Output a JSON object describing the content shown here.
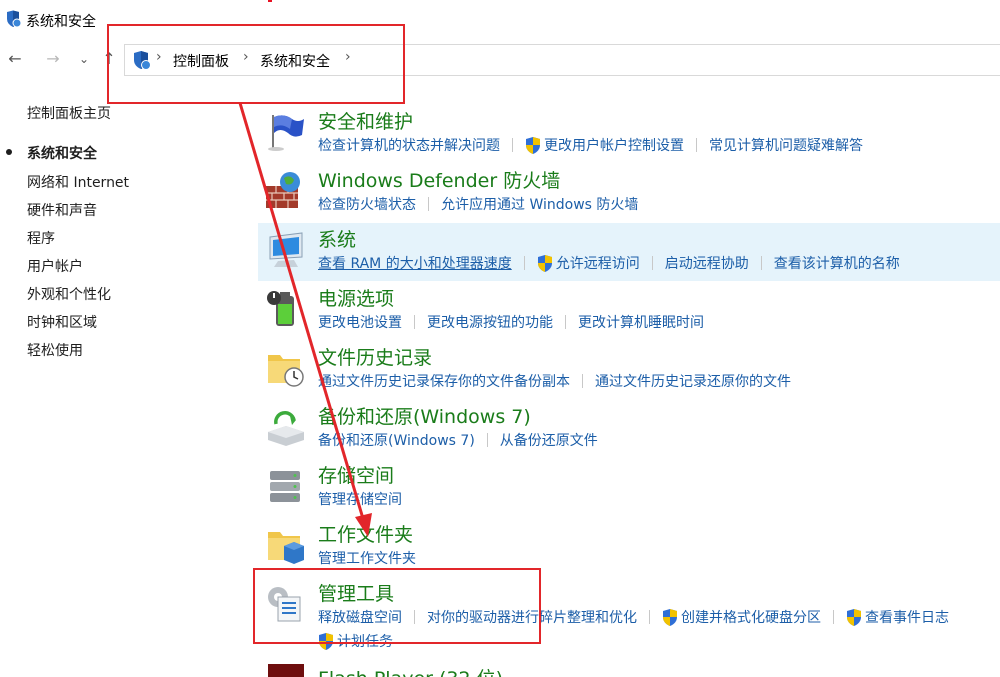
{
  "window": {
    "title": "系统和安全"
  },
  "breadcrumb": [
    {
      "label": "控制面板"
    },
    {
      "label": "系统和安全"
    }
  ],
  "left_nav": {
    "home": "控制面板主页",
    "items": [
      "系统和安全",
      "网络和 Internet",
      "硬件和声音",
      "程序",
      "用户帐户",
      "外观和个性化",
      "时钟和区域",
      "轻松使用"
    ],
    "current_index": 0
  },
  "categories": [
    {
      "title": "安全和维护",
      "icon": "flag-icon",
      "links": [
        {
          "label": "检查计算机的状态并解决问题",
          "shield": false
        },
        {
          "label": "更改用户帐户控制设置",
          "shield": true
        },
        {
          "label": "常见计算机问题疑难解答",
          "shield": false
        }
      ]
    },
    {
      "title": "Windows Defender 防火墙",
      "icon": "firewall-icon",
      "links": [
        {
          "label": "检查防火墙状态",
          "shield": false
        },
        {
          "label": "允许应用通过 Windows 防火墙",
          "shield": false
        }
      ]
    },
    {
      "title": "系统",
      "icon": "computer-icon",
      "links": [
        {
          "label": "查看 RAM 的大小和处理器速度",
          "shield": false
        },
        {
          "label": "允许远程访问",
          "shield": true
        },
        {
          "label": "启动远程协助",
          "shield": false
        },
        {
          "label": "查看该计算机的名称",
          "shield": false
        }
      ]
    },
    {
      "title": "电源选项",
      "icon": "battery-icon",
      "links": [
        {
          "label": "更改电池设置",
          "shield": false
        },
        {
          "label": "更改电源按钮的功能",
          "shield": false
        },
        {
          "label": "更改计算机睡眠时间",
          "shield": false
        }
      ]
    },
    {
      "title": "文件历史记录",
      "icon": "file-history-icon",
      "links": [
        {
          "label": "通过文件历史记录保存你的文件备份副本",
          "shield": false
        },
        {
          "label": "通过文件历史记录还原你的文件",
          "shield": false
        }
      ]
    },
    {
      "title": "备份和还原(Windows 7)",
      "icon": "backup-icon",
      "links": [
        {
          "label": "备份和还原(Windows 7)",
          "shield": false
        },
        {
          "label": "从备份还原文件",
          "shield": false
        }
      ]
    },
    {
      "title": "存储空间",
      "icon": "storage-icon",
      "links": [
        {
          "label": "管理存储空间",
          "shield": false
        }
      ]
    },
    {
      "title": "工作文件夹",
      "icon": "work-folder-icon",
      "links": [
        {
          "label": "管理工作文件夹",
          "shield": false
        }
      ]
    },
    {
      "title": "管理工具",
      "icon": "admin-tools-icon",
      "links": [
        {
          "label": "释放磁盘空间",
          "shield": false
        },
        {
          "label": "对你的驱动器进行碎片整理和优化",
          "shield": false
        },
        {
          "label": "创建并格式化硬盘分区",
          "shield": true
        },
        {
          "label": "查看事件日志",
          "shield": true
        }
      ],
      "links2": [
        {
          "label": "计划任务",
          "shield": true
        }
      ]
    },
    {
      "title": "Flash Player (32 位)",
      "icon": "flash-icon",
      "links": []
    }
  ],
  "colors": {
    "accent_green": "#1a7c1a",
    "link_blue": "#1c5ea8",
    "annotation_red": "#e2262a",
    "hover_bg": "#e5f3fb"
  }
}
